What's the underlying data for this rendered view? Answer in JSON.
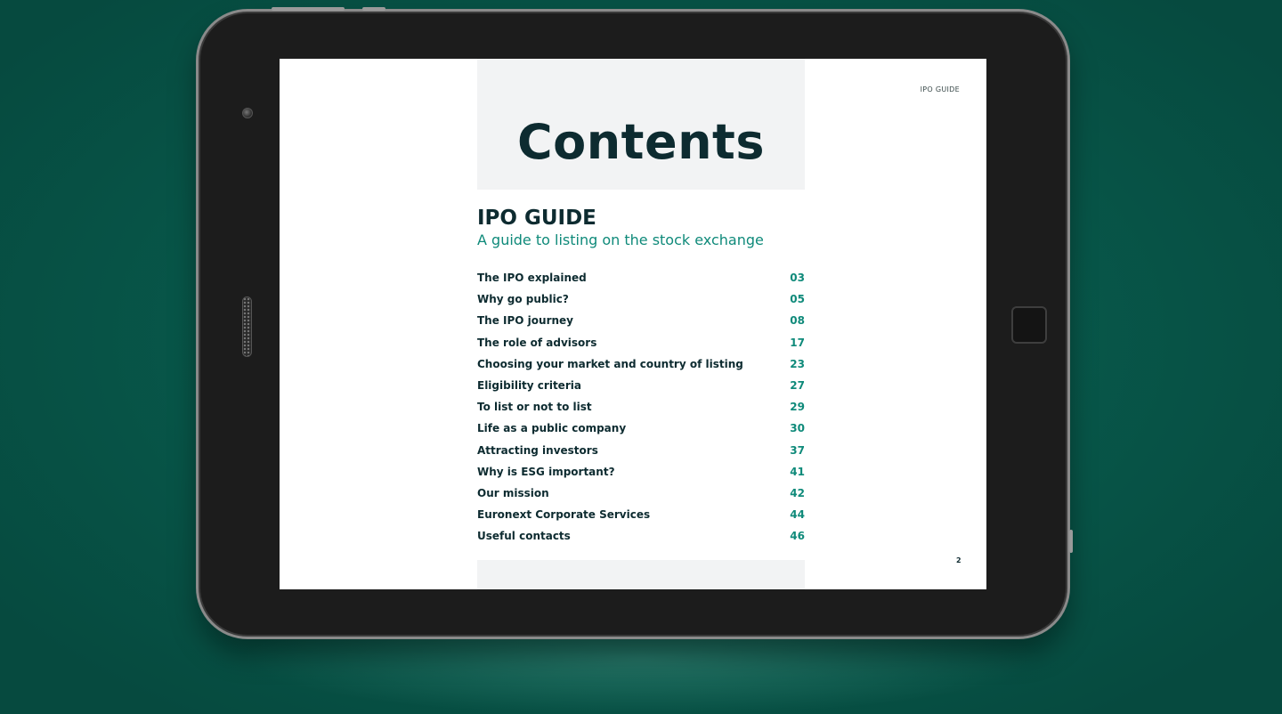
{
  "document": {
    "running_head": "IPO GUIDE",
    "page_number": "2",
    "heading": "Contents",
    "guide_title": "IPO GUIDE",
    "guide_subtitle": "A guide to listing on the stock exchange",
    "toc": [
      {
        "label": "The IPO explained",
        "page": "03"
      },
      {
        "label": "Why go public?",
        "page": "05"
      },
      {
        "label": "The IPO journey",
        "page": "08"
      },
      {
        "label": "The role of advisors",
        "page": "17"
      },
      {
        "label": "Choosing your market and country of listing",
        "page": "23"
      },
      {
        "label": "Eligibility criteria",
        "page": "27"
      },
      {
        "label": "To list or not to list",
        "page": "29"
      },
      {
        "label": "Life as a public company",
        "page": "30"
      },
      {
        "label": "Attracting investors",
        "page": "37"
      },
      {
        "label": "Why is ESG important?",
        "page": "41"
      },
      {
        "label": "Our mission",
        "page": "42"
      },
      {
        "label": "Euronext Corporate Services",
        "page": "44"
      },
      {
        "label": "Useful contacts",
        "page": "46"
      }
    ]
  },
  "colors": {
    "background": "#08594b",
    "heading": "#0d2b30",
    "accent": "#0f8a7a",
    "title_box": "#f2f3f4"
  },
  "device": {
    "camera_icon": "camera-icon",
    "speaker_icon": "speaker-grille-icon",
    "home_button_icon": "home-button-icon"
  }
}
